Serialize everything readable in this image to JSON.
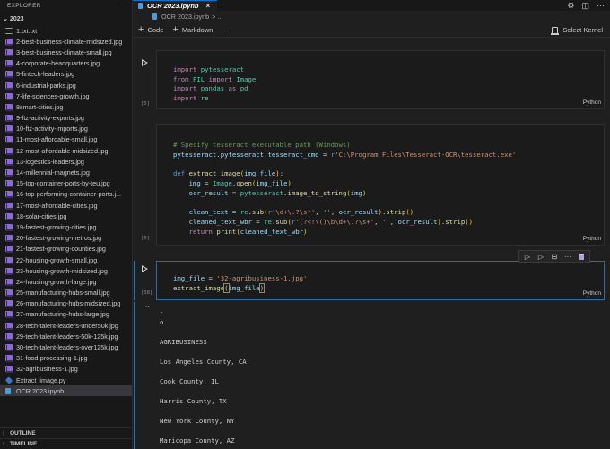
{
  "explorer": {
    "title": "EXPLORER",
    "more_icon": "ellipsis-icon",
    "folder": "2023",
    "files": [
      {
        "name": "1.txt.txt",
        "icon": "text-file-icon"
      },
      {
        "name": "2-best-business-climate-midsized.jpg",
        "icon": "image-file-icon"
      },
      {
        "name": "3-best-business-climate-small.jpg",
        "icon": "image-file-icon"
      },
      {
        "name": "4-corporate-headquarters.jpg",
        "icon": "image-file-icon"
      },
      {
        "name": "5-fintech-leaders.jpg",
        "icon": "image-file-icon"
      },
      {
        "name": "6-industrial-parks.jpg",
        "icon": "image-file-icon"
      },
      {
        "name": "7-life-sciences-growth.jpg",
        "icon": "image-file-icon"
      },
      {
        "name": "8smart-cities.jpg",
        "icon": "image-file-icon"
      },
      {
        "name": "9-ftz-activity-exports.jpg",
        "icon": "image-file-icon"
      },
      {
        "name": "10-ftz-activity-imports.jpg",
        "icon": "image-file-icon"
      },
      {
        "name": "11-most-affordable-small.jpg",
        "icon": "image-file-icon"
      },
      {
        "name": "12-most-affordable-midsized.jpg",
        "icon": "image-file-icon"
      },
      {
        "name": "13-logestics-leaders.jpg",
        "icon": "image-file-icon"
      },
      {
        "name": "14-millennial-magnets.jpg",
        "icon": "image-file-icon"
      },
      {
        "name": "15-top-container-ports-by-teu.jpg",
        "icon": "image-file-icon"
      },
      {
        "name": "16-top-performing-container-ports.j...",
        "icon": "image-file-icon"
      },
      {
        "name": "17-most-affordable-cities.jpg",
        "icon": "image-file-icon"
      },
      {
        "name": "18-solar-cities.jpg",
        "icon": "image-file-icon"
      },
      {
        "name": "19-fastest-growing-cities.jpg",
        "icon": "image-file-icon"
      },
      {
        "name": "20-fastest-growing-metros.jpg",
        "icon": "image-file-icon"
      },
      {
        "name": "21-fastest-growing-counties.jpg",
        "icon": "image-file-icon"
      },
      {
        "name": "22-housing-growth-small.jpg",
        "icon": "image-file-icon"
      },
      {
        "name": "23-housing-growth-midsized.jpg",
        "icon": "image-file-icon"
      },
      {
        "name": "24-housing-growth-large.jpg",
        "icon": "image-file-icon"
      },
      {
        "name": "25-manufacturing-hubs-small.jpg",
        "icon": "image-file-icon"
      },
      {
        "name": "26-manufacturing-hubs-midsized.jpg",
        "icon": "image-file-icon"
      },
      {
        "name": "27-manufacturing-hubs-large.jpg",
        "icon": "image-file-icon"
      },
      {
        "name": "28-tech-talent-leaders-under50k.jpg",
        "icon": "image-file-icon"
      },
      {
        "name": "29-tech-talent-leaders-50k-125k.jpg",
        "icon": "image-file-icon"
      },
      {
        "name": "30-tech-talent-leaders-over125k.jpg",
        "icon": "image-file-icon"
      },
      {
        "name": "31-food-processing-1.jpg",
        "icon": "image-file-icon"
      },
      {
        "name": "32-agribusiness-1.jpg",
        "icon": "image-file-icon"
      },
      {
        "name": "Extract_image.py",
        "icon": "python-file-icon"
      },
      {
        "name": "OCR 2023.ipynb",
        "icon": "notebook-file-icon",
        "selected": true
      }
    ],
    "sections": [
      "OUTLINE",
      "TIMELINE"
    ]
  },
  "tab": {
    "label": "OCR 2023.ipynb",
    "close": "×"
  },
  "breadcrumb": {
    "file": "OCR 2023.ipynb",
    "rest": "> ..."
  },
  "toolbar": {
    "code_label": "Code",
    "markdown_label": "Markdown",
    "more": "···",
    "kernel_label": "Select Kernel"
  },
  "cells": [
    {
      "exec": "[5]",
      "language": "Python",
      "lines": [
        "import pytesseract",
        "from PIL import Image",
        "import pandas as pd",
        "import re"
      ]
    },
    {
      "exec": "[6]",
      "language": "Python",
      "lines": [
        "# Specify tesseract executable path (Windows)",
        "pytesseract.pytesseract.tesseract_cmd = r'C:\\Program Files\\Tesseract-OCR\\tesseract.exe'",
        "",
        "def extract_image(img_file):",
        "    img = Image.open(img_file)",
        "    ocr_result = pytesseract.image_to_string(img)",
        "",
        "    clean_text = re.sub(r'\\d+\\.?\\s*', '', ocr_result).strip()",
        "    cleaned_text_wbr = re.sub(r'(?<!\\()\\b\\d+\\.?\\s+', '', ocr_result).strip()",
        "    return print(cleaned_text_wbr)"
      ]
    },
    {
      "exec": "[38]",
      "language": "Python",
      "lines": [
        "img_file = '32-agribusiness-1.jpg'",
        "extract_image(img_file)"
      ]
    }
  ],
  "output": {
    "menu": "···",
    "lines": [
      "-",
      "o",
      "",
      "AGRIBUSINESS",
      "",
      "Los Angeles County, CA",
      "",
      "Cook County, IL",
      "",
      "Harris County, TX",
      "",
      "New York County, NY",
      "",
      "Maricopa County, AZ"
    ]
  }
}
